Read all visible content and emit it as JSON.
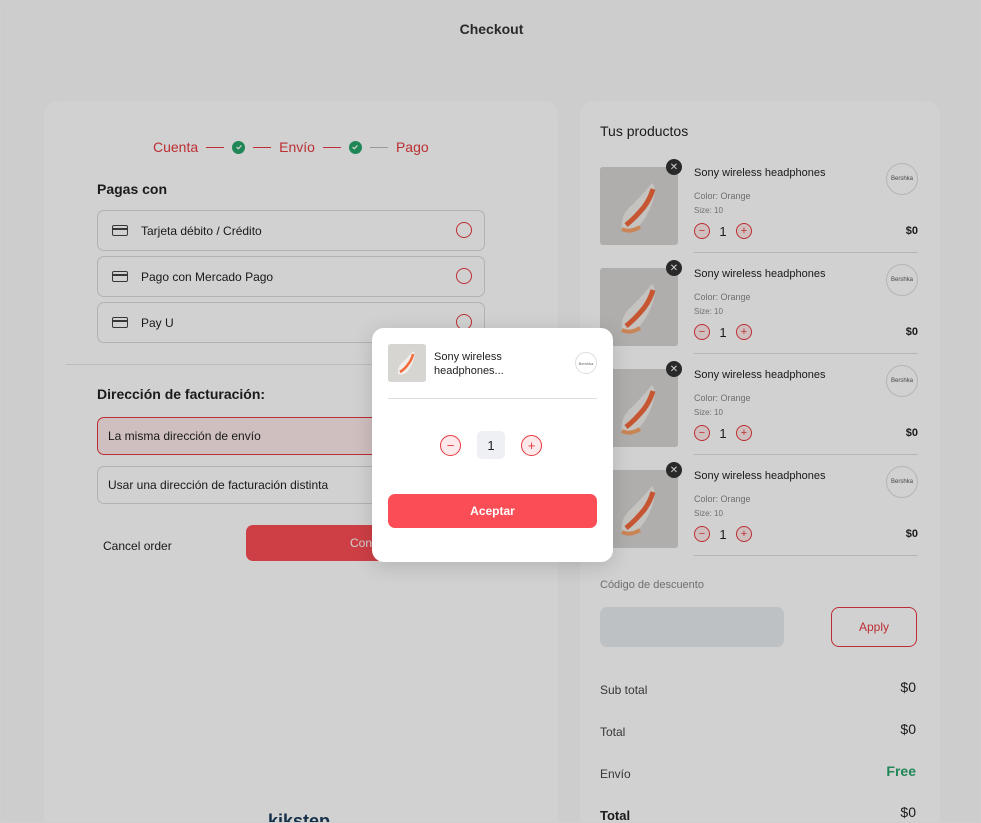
{
  "page": {
    "title": "Checkout"
  },
  "stepper": {
    "step1": "Cuenta",
    "step2": "Envío",
    "step3": "Pago"
  },
  "payment": {
    "title": "Pagas con",
    "options": [
      "Tarjeta débito / Crédito",
      "Pago con Mercado Pago",
      "Pay U"
    ]
  },
  "billing": {
    "title": "Dirección de facturación:",
    "options": [
      "La misma dirección de envío",
      "Usar una dirección de facturación distinta"
    ]
  },
  "actions": {
    "cancel_label": "Cancel order",
    "confirm_label": "Confirm a"
  },
  "footer": {
    "logo_text": "kikstep"
  },
  "cart": {
    "title": "Tus productos",
    "items": [
      {
        "name": "Sony wireless headphones",
        "color": "Color: Orange",
        "size": "Size: 10",
        "qty": "1",
        "price": "$0",
        "brand": "Bershka"
      },
      {
        "name": "Sony wireless headphones",
        "color": "Color: Orange",
        "size": "Size: 10",
        "qty": "1",
        "price": "$0",
        "brand": "Bershka"
      },
      {
        "name": "Sony wireless headphones",
        "color": "Color: Orange",
        "size": "Size: 10",
        "qty": "1",
        "price": "$0",
        "brand": "Bershka"
      },
      {
        "name": "Sony wireless headphones",
        "color": "Color: Orange",
        "size": "Size: 10",
        "qty": "1",
        "price": "$0",
        "brand": "Bershka"
      }
    ],
    "discount_label": "Código de descuento",
    "apply_label": "Apply"
  },
  "summary": {
    "subtotal_label": "Sub total",
    "subtotal_value": "$0",
    "total_label": "Total",
    "total_value": "$0",
    "shipping_label": "Envío",
    "shipping_value": "Free",
    "grand_total_label": "Total",
    "grand_total_value": "$0"
  },
  "modal": {
    "product_name": "Sony wireless headphones...",
    "brand": "Bershka",
    "qty": "1",
    "accept_label": "Aceptar"
  },
  "colors": {
    "accent": "#fb4d55",
    "success": "#27a56b"
  },
  "icons": {
    "check": "check-icon",
    "card": "credit-card-icon",
    "remove": "close-icon",
    "minus": "minus-icon",
    "plus": "plus-icon"
  }
}
